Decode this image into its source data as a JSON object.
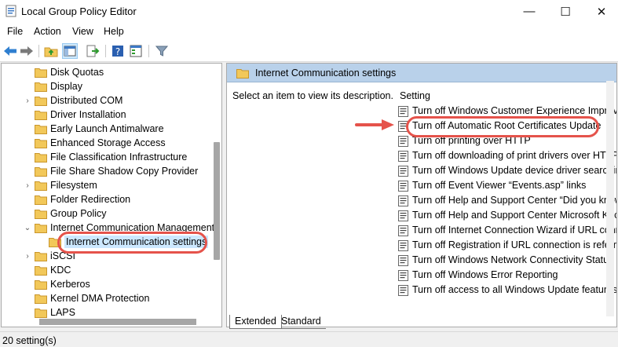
{
  "window": {
    "title": "Local Group Policy Editor",
    "minimize_glyph": "—",
    "maximize_glyph": "☐",
    "close_glyph": "✕"
  },
  "menu": [
    "File",
    "Action",
    "View",
    "Help"
  ],
  "toolbar_icons": [
    "back-arrow-icon",
    "forward-arrow-icon",
    "up-folder-icon",
    "show-hide-tree-icon",
    "export-list-icon",
    "help-icon",
    "properties-icon",
    "filter-icon"
  ],
  "tree": {
    "items": [
      {
        "label": "Disk Quotas",
        "expandable": false
      },
      {
        "label": "Display",
        "expandable": false
      },
      {
        "label": "Distributed COM",
        "expandable": true
      },
      {
        "label": "Driver Installation",
        "expandable": false
      },
      {
        "label": "Early Launch Antimalware",
        "expandable": false
      },
      {
        "label": "Enhanced Storage Access",
        "expandable": false
      },
      {
        "label": "File Classification Infrastructure",
        "expandable": false
      },
      {
        "label": "File Share Shadow Copy Provider",
        "expandable": false
      },
      {
        "label": "Filesystem",
        "expandable": true
      },
      {
        "label": "Folder Redirection",
        "expandable": false
      },
      {
        "label": "Group Policy",
        "expandable": false
      },
      {
        "label": "Internet Communication Management",
        "expandable": true,
        "expanded": true
      },
      {
        "label": "Internet Communication settings",
        "child": true,
        "selected": true
      },
      {
        "label": "iSCSI",
        "expandable": true
      },
      {
        "label": "KDC",
        "expandable": false
      },
      {
        "label": "Kerberos",
        "expandable": false
      },
      {
        "label": "Kernel DMA Protection",
        "expandable": false
      },
      {
        "label": "LAPS",
        "expandable": false
      }
    ]
  },
  "right_pane": {
    "header": "Internet Communication settings",
    "description": "Select an item to view its description.",
    "column_header": "Setting",
    "settings": [
      "Turn off Windows Customer Experience Improve",
      "Turn off Automatic Root Certificates Update",
      "Turn off printing over HTTP",
      "Turn off downloading of print drivers over HTTP",
      "Turn off Windows Update device driver searchin",
      "Turn off Event Viewer “Events.asp” links",
      "Turn off Help and Support Center “Did you know",
      "Turn off Help and Support Center Microsoft Knc",
      "Turn off Internet Connection Wizard if URL conn",
      "Turn off Registration if URL connection is referrir",
      "Turn off Windows Network Connectivity Status I",
      "Turn off Windows Error Reporting",
      "Turn off access to all Windows Update features"
    ]
  },
  "tabs": [
    "Extended",
    "Standard"
  ],
  "status": "20 setting(s)",
  "colors": {
    "highlight": "#e5534b",
    "header_bg": "#b9d1ea",
    "folder": "#f2c85a",
    "selection": "#cce8ff"
  }
}
